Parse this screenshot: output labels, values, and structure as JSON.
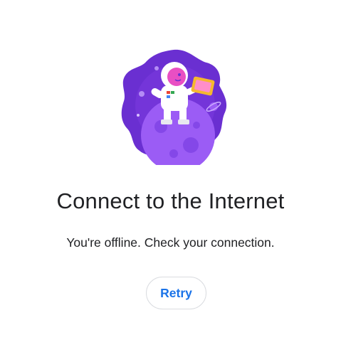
{
  "illustration": {
    "icon": "astronaut-on-planet-offline-illustration",
    "colors": {
      "blob": "#6a2fd1",
      "planet": "#9b5cf5",
      "accent": "#e94fc3",
      "tablet": "#f5b82e"
    }
  },
  "error": {
    "title": "Connect to the Internet",
    "message": "You're offline. Check your connection."
  },
  "actions": {
    "retry_label": "Retry"
  },
  "colors": {
    "title_text": "#202124",
    "button_text": "#1a73e8",
    "button_border": "#dadce0"
  }
}
